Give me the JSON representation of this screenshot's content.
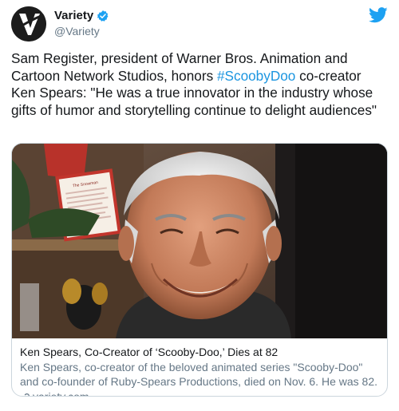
{
  "user": {
    "name": "Variety",
    "handle": "@Variety"
  },
  "tweet": {
    "text_before": "Sam Register, president of Warner Bros. Animation and Cartoon Network Studios, honors ",
    "hashtag": "#ScoobyDoo",
    "text_after": " co-creator Ken Spears: \"He was a true innovator in the industry whose gifts of humor and storytelling continue to delight audiences\""
  },
  "card": {
    "image_caption": "The Snowman",
    "title": "Ken Spears, Co-Creator of ‘Scooby-Doo,’ Dies at 82",
    "description": "Ken Spears, co-creator of the beloved animated series \"Scooby-Doo\" and co-founder of Ruby-Spears Productions, died on Nov. 6. He was 82.",
    "domain": "variety.com"
  },
  "icons": {
    "verified": "verified-badge-icon",
    "twitter": "twitter-bird-icon",
    "link": "link-icon"
  },
  "colors": {
    "accent": "#1b95e0",
    "secondary_text": "#657786",
    "border": "#ccd6dd"
  }
}
